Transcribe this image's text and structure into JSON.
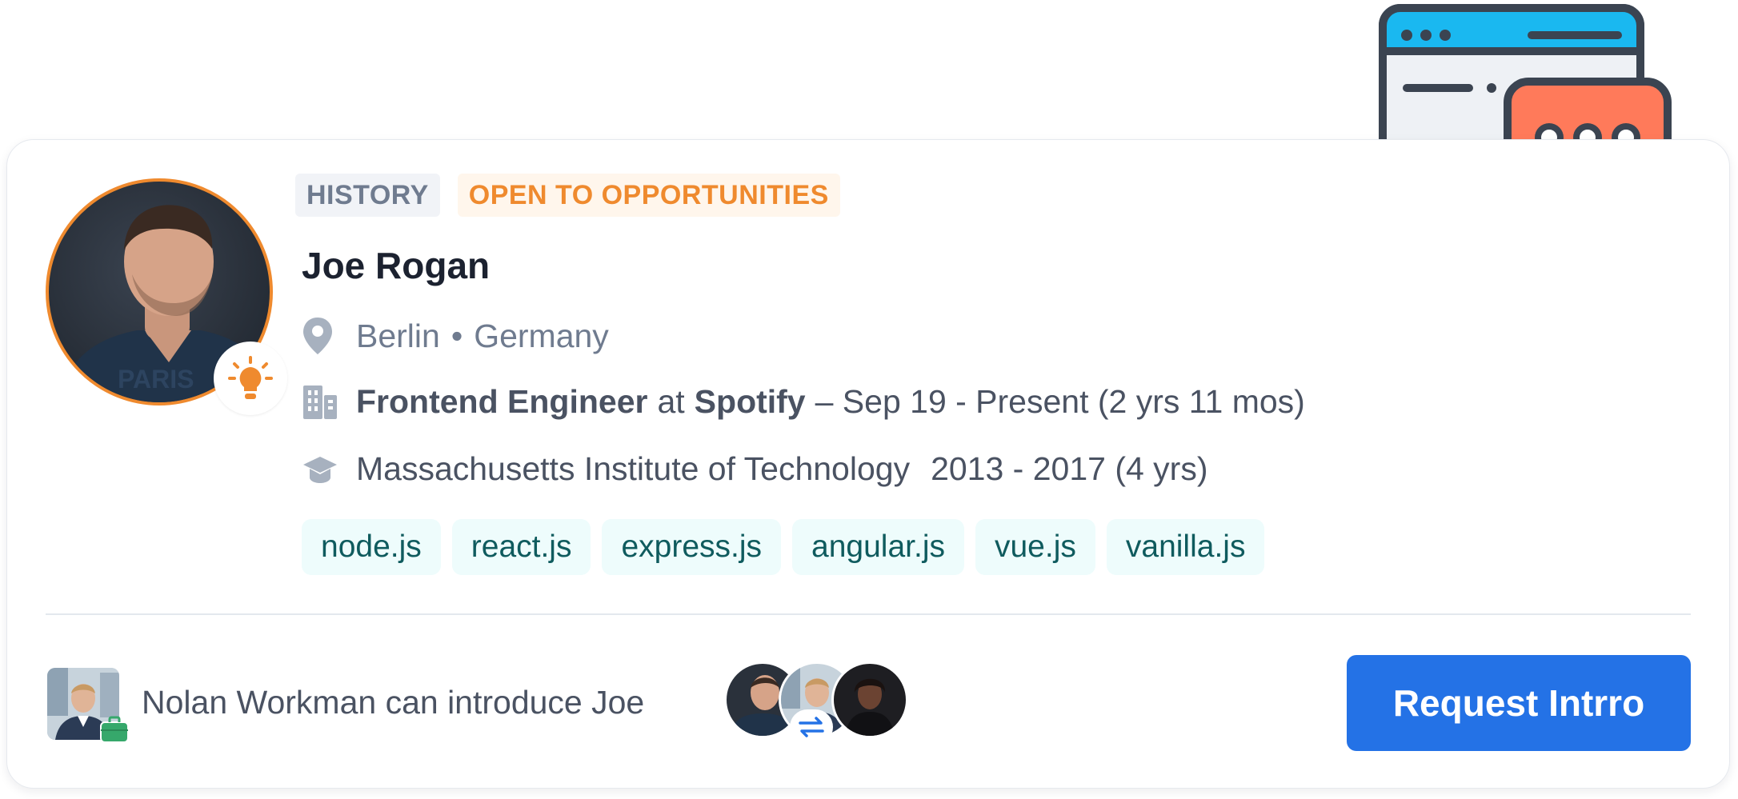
{
  "profile": {
    "tags": {
      "history": "HISTORY",
      "open": "OPEN TO OPPORTUNITIES"
    },
    "name": "Joe Rogan",
    "location": {
      "city": "Berlin",
      "separator": "•",
      "country": "Germany"
    },
    "job": {
      "title": "Frontend Engineer",
      "at": "at",
      "company": "Spotify",
      "period": "– Sep 19 - Present (2 yrs 11 mos)"
    },
    "education": {
      "school": "Massachusetts Institute of Technology",
      "period": "2013 - 2017 (4 yrs)"
    },
    "skills": [
      "node.js",
      "react.js",
      "express.js",
      "angular.js",
      "vue.js",
      "vanilla.js"
    ]
  },
  "intro": {
    "text": "Nolan Workman can introduce Joe",
    "button_label": "Request Intrro"
  },
  "icons": {
    "badge": "lightbulb-icon",
    "location": "map-pin-icon",
    "job": "building-icon",
    "education": "graduation-cap-icon",
    "intro_badge": "briefcase-icon",
    "swap": "swap-arrows-icon",
    "illustration": "chat-window-illustration"
  },
  "colors": {
    "accent": "#ef8a2e",
    "primary": "#2472e6",
    "skill_bg": "#eefcfc",
    "skill_text": "#0f5b5e",
    "muted": "#6f7b8f"
  }
}
